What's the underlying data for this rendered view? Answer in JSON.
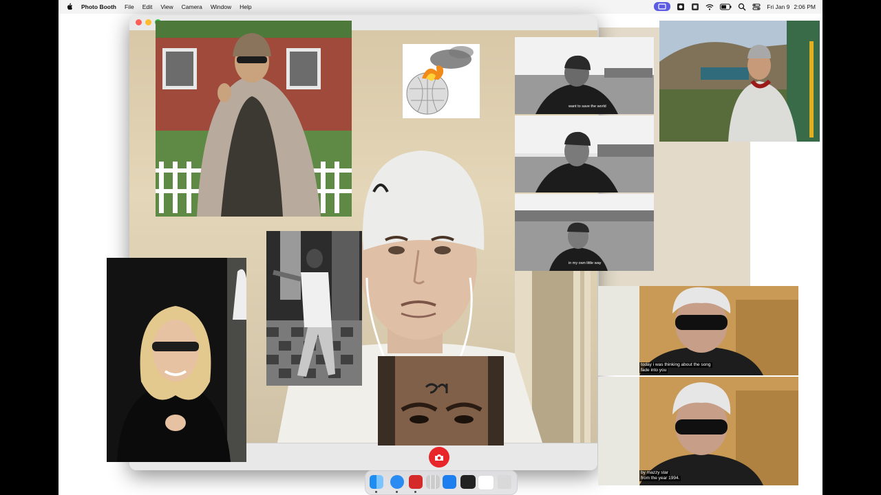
{
  "menubar": {
    "app_name": "Photo Booth",
    "menus": [
      "File",
      "Edit",
      "View",
      "Camera",
      "Window",
      "Help"
    ],
    "date": "Fri Jan 9",
    "time": "2:06 PM"
  },
  "photobooth": {
    "window_icons": [
      "close-icon",
      "minimize-icon",
      "maximize-icon"
    ],
    "shutter_icon": "camera-icon"
  },
  "subtitles": {
    "bw_top": "want to save the world",
    "bw_bottom": "in my own little way",
    "top_line1": "today i was thinking about the song",
    "top_line2": "fade into you",
    "bottom_line1": "by mazzy star",
    "bottom_line2": "from the year 1994."
  },
  "dock": {
    "apps": [
      "finder-icon",
      "safari-icon",
      "photo-booth-icon",
      "launchpad-icon",
      "app-store-icon",
      "video-thumbnail-icon",
      "blank-window-icon",
      "trash-icon"
    ]
  },
  "colors": {
    "menu_badge": "#5b5ce2",
    "shutter": "#e8262a"
  }
}
